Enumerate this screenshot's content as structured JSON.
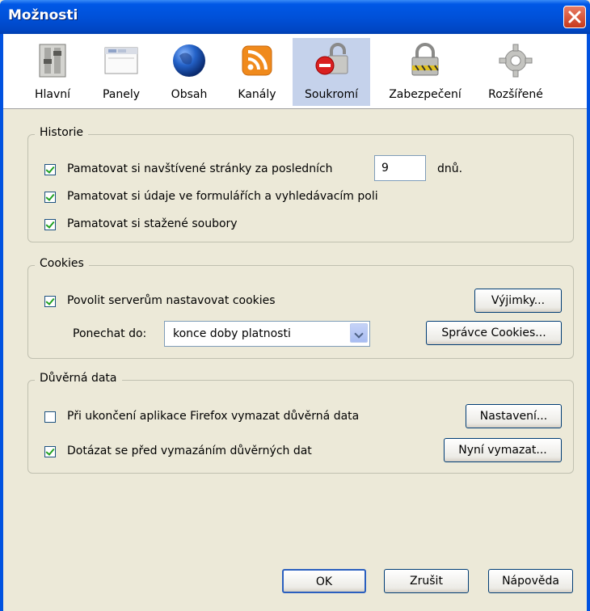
{
  "window": {
    "title": "Možnosti"
  },
  "tabs": [
    {
      "label": "Hlavní",
      "icon": "switch-icon"
    },
    {
      "label": "Panely",
      "icon": "tabs-window-icon"
    },
    {
      "label": "Obsah",
      "icon": "globe-icon"
    },
    {
      "label": "Kanály",
      "icon": "rss-feed-icon"
    },
    {
      "label": "Soukromí",
      "icon": "privacy-lock-icon",
      "selected": true
    },
    {
      "label": "Zabezpečení",
      "icon": "padlock-icon"
    },
    {
      "label": "Rozšířené",
      "icon": "gear-icon"
    }
  ],
  "history": {
    "legend": "Historie",
    "remember_visited_label": "Pamatovat si navštívené stránky za posledních",
    "remember_visited_checked": true,
    "days_value": "9",
    "days_unit": "dnů.",
    "remember_forms_label": "Pamatovat si údaje ve formulářích a vyhledávacím poli",
    "remember_forms_checked": true,
    "remember_downloads_label": "Pamatovat si stažené soubory",
    "remember_downloads_checked": true
  },
  "cookies": {
    "legend": "Cookies",
    "allow_label": "Povolit serverům nastavovat cookies",
    "allow_checked": true,
    "exceptions_button": "Výjimky...",
    "keep_until_label": "Ponechat do:",
    "keep_until_value": "konce doby platnosti",
    "manager_button": "Správce Cookies..."
  },
  "private_data": {
    "legend": "Důvěrná data",
    "clear_on_exit_label": "Při ukončení aplikace Firefox vymazat důvěrná data",
    "clear_on_exit_checked": false,
    "settings_button": "Nastavení...",
    "ask_before_label": "Dotázat se před vymazáním důvěrných dat",
    "ask_before_checked": true,
    "clear_now_button": "Nyní vymazat..."
  },
  "footer": {
    "ok_button": "OK",
    "cancel_button": "Zrušit",
    "help_button": "Nápověda"
  },
  "colors": {
    "titlebar": "#0051d9",
    "dialog_bg": "#ece9d8",
    "selected_tab": "#c5d2eb",
    "checkmark": "#21a121"
  }
}
